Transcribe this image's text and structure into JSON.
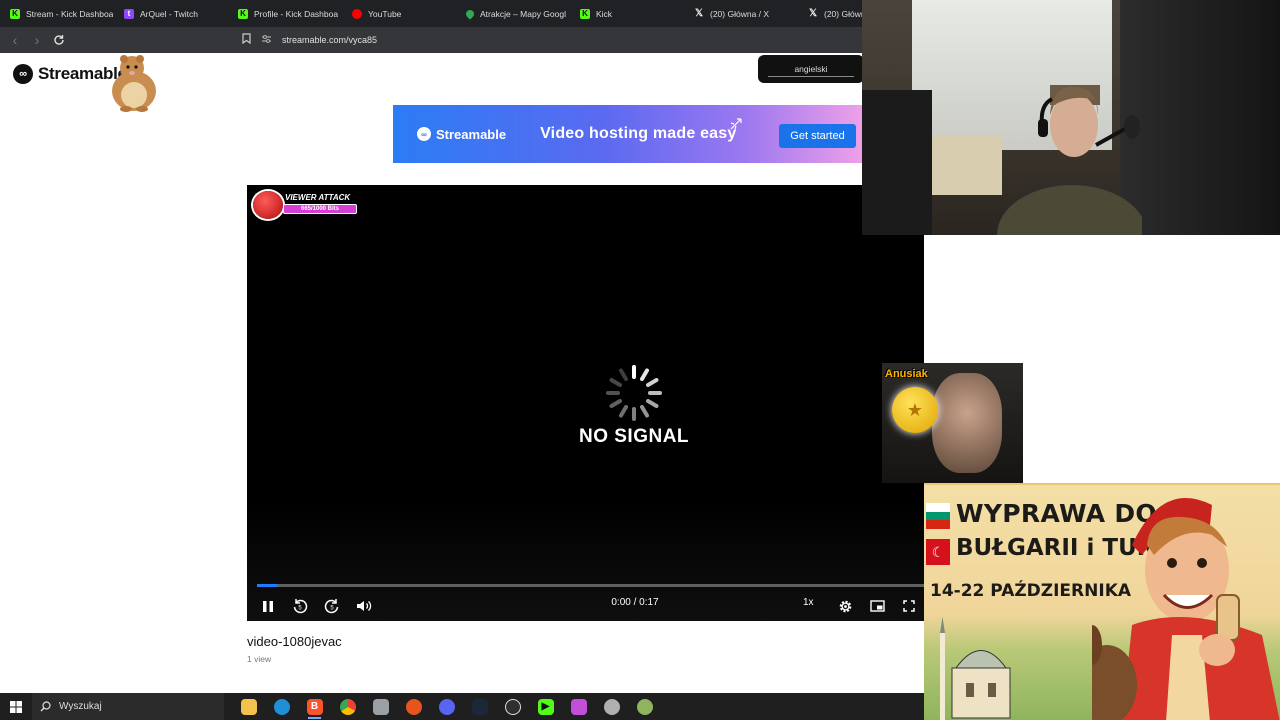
{
  "browser": {
    "tabs": [
      {
        "title": "Stream - Kick Dashboa",
        "icon": "kick-icon"
      },
      {
        "title": "ArQuel - Twitch",
        "icon": "twitch-icon"
      },
      {
        "title": "Profile - Kick Dashboa",
        "icon": "kick-icon"
      },
      {
        "title": "YouTube",
        "icon": "youtube-icon"
      },
      {
        "title": "Atrakcje – Mapy Googl",
        "icon": "maps-icon"
      },
      {
        "title": "Kick",
        "icon": "kick-icon"
      },
      {
        "title": "(20) Główna / X",
        "icon": "x-icon"
      },
      {
        "title": "(20) Główn",
        "icon": "x-icon"
      }
    ],
    "url": "streamable.com/vyca85"
  },
  "site": {
    "logo_text": "Streamable",
    "language": "angielski"
  },
  "banner": {
    "brand": "Streamable",
    "tagline": "Video hosting made easy",
    "cta": "Get started"
  },
  "player": {
    "overlay_title": "VIEWER ATTACK",
    "overlay_progress": "665/1000 Bits",
    "status": "NO SIGNAL",
    "time": "0:00 / 0:17",
    "speed": "1x",
    "progress_fraction": 0.03
  },
  "video": {
    "title": "video-1080jevac",
    "views": "1 view"
  },
  "stream_overlay": {
    "small_cam_name": "Anusiak"
  },
  "promo": {
    "line1": "WYPRAWA DO",
    "line2": "BUŁGARII i TURCJI",
    "dates": "14-22 PAŹDZIERNIKA"
  },
  "taskbar": {
    "search_placeholder": "Wyszukaj",
    "pinned": [
      "file-explorer-icon",
      "edge-icon",
      "brave-icon",
      "chrome-icon",
      "app-icon",
      "app-icon",
      "discord-icon",
      "steam-icon",
      "obs-icon",
      "media-icon",
      "app-icon",
      "app-icon",
      "app-icon"
    ]
  },
  "colors": {
    "accent": "#1f7bff",
    "kick_green": "#53fc18",
    "twitch_purple": "#9146ff"
  }
}
